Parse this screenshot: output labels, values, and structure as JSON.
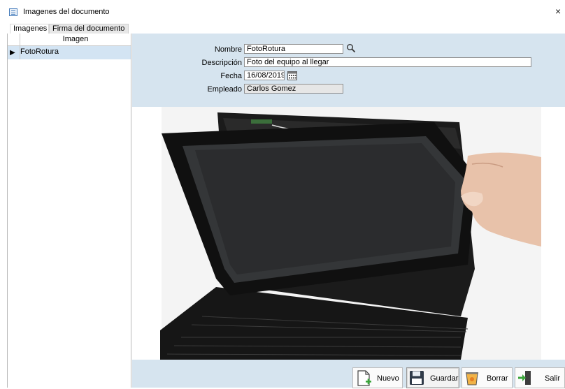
{
  "window": {
    "title": "Imagenes del documento",
    "close_glyph": "×"
  },
  "tabs": [
    {
      "label": "Imagenes"
    },
    {
      "label": "Firma del documento"
    }
  ],
  "grid": {
    "header": "Imagen",
    "rows": [
      {
        "indicator": "▶",
        "value": "FotoRotura"
      }
    ]
  },
  "form": {
    "nombre": {
      "label": "Nombre",
      "value": "FotoRotura"
    },
    "descripcion": {
      "label": "Descripción",
      "value": "Foto del equipo al llegar"
    },
    "fecha": {
      "label": "Fecha",
      "value": "16/08/2019"
    },
    "empleado": {
      "label": "Empleado",
      "value": "Carlos Gomez"
    }
  },
  "toolbar": {
    "nuevo": "Nuevo",
    "guardar": "Guardar",
    "borrar": "Borrar",
    "salir": "Salir"
  },
  "icons": {
    "search": "magnifier-icon",
    "calendar": "calendar-icon",
    "new": "new-document-icon",
    "save": "floppy-disk-icon",
    "delete": "trash-bin-icon",
    "exit": "exit-door-icon"
  }
}
